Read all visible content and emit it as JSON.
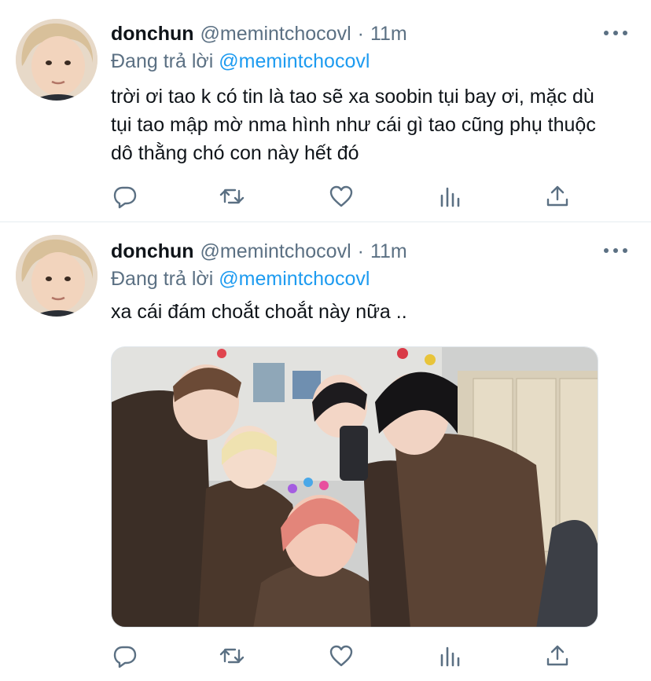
{
  "tweets": [
    {
      "name": "donchun",
      "handle": "@memintchocovl",
      "dot": "·",
      "time": "11m",
      "reply_prefix": "Đang trả lời",
      "reply_to": "@memintchocovl",
      "text": "trời ơi tao k có tin là tao sẽ xa soobin tụi bay ơi, mặc dù tụi tao mập mờ nma hình như cái gì tao cũng phụ thuộc dô thằng chó con này hết đó"
    },
    {
      "name": "donchun",
      "handle": "@memintchocovl",
      "dot": "·",
      "time": "11m",
      "reply_prefix": "Đang trả lời",
      "reply_to": "@memintchocovl",
      "text": "xa cái đám choắt choắt này nữa ..",
      "media": "photo"
    }
  ],
  "icons": {
    "reply": "reply-icon",
    "retweet": "retweet-icon",
    "like": "like-icon",
    "stats": "stats-icon",
    "share": "share-icon",
    "more": "more-icon"
  },
  "colors": {
    "accent": "#1d9bf0",
    "secondary_text": "#5b7083",
    "divider": "#e6ecf0"
  }
}
